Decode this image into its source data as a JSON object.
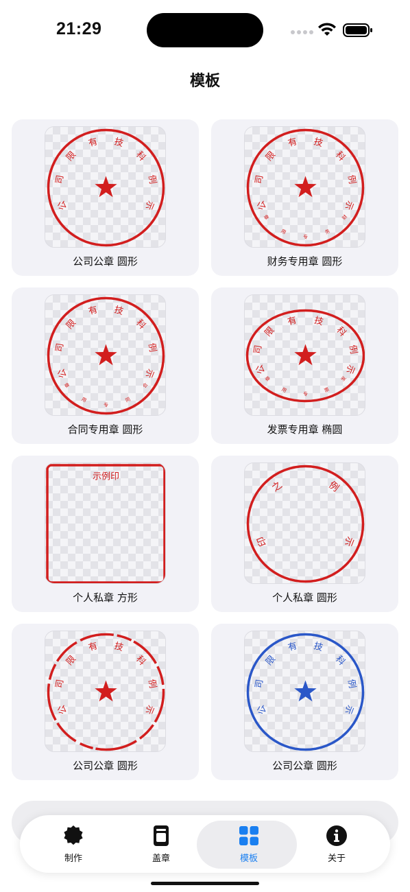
{
  "status_bar": {
    "time": "21:29"
  },
  "page_title": "模板",
  "colors": {
    "stamp_red": "#d21e1e",
    "stamp_blue": "#2a57c8",
    "accent": "#1a7ff0"
  },
  "templates": [
    {
      "label": "公司公章 圆形"
    },
    {
      "label": "财务专用章 圆形"
    },
    {
      "label": "合同专用章 圆形"
    },
    {
      "label": "发票专用章 椭圆"
    },
    {
      "label": "个人私章 方形"
    },
    {
      "label": "个人私章 圆形"
    },
    {
      "label": "公司公章 圆形"
    },
    {
      "label": "公司公章 圆形"
    }
  ],
  "stamps": {
    "company_arc": [
      "公",
      "司",
      "限",
      "有",
      "技",
      "科",
      "例",
      "示"
    ],
    "finance_arc": [
      "公",
      "司",
      "限",
      "有",
      "技",
      "科",
      "例",
      "示"
    ],
    "finance_bottom": [
      "章",
      "用",
      "专",
      "务",
      "财"
    ],
    "contract_bottom": [
      "章",
      "用",
      "专",
      "同",
      "合"
    ],
    "invoice_bottom": [
      "章",
      "用",
      "专",
      "票",
      "发"
    ],
    "personal_square_text": "示例印",
    "personal_round_arc": [
      "印",
      "之",
      "例",
      "示"
    ]
  },
  "tabs": [
    {
      "label": "制作",
      "icon": "badge-icon"
    },
    {
      "label": "盖章",
      "icon": "stamp-icon"
    },
    {
      "label": "模板",
      "icon": "grid-icon",
      "active": true
    },
    {
      "label": "关于",
      "icon": "info-icon"
    }
  ]
}
